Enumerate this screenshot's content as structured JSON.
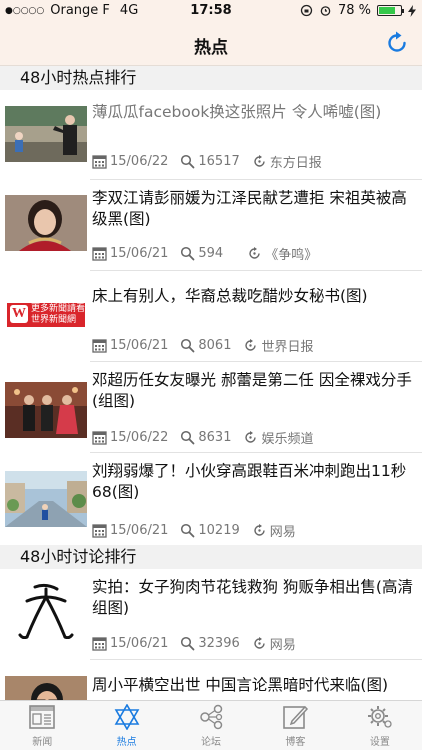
{
  "status": {
    "carrier": "Orange F",
    "network": "4G",
    "time": "17:58",
    "battery": "78 %",
    "battery_level": 0.78
  },
  "nav": {
    "title": "热点"
  },
  "sections": [
    {
      "title": "48小时热点排行"
    },
    {
      "title": "48小时讨论排行"
    }
  ],
  "articles": [
    {
      "title": "薄瓜瓜facebook换这张照片 令人唏嘘(图)",
      "date": "15/06/22",
      "views": "16517",
      "source": "东方日报",
      "read": true
    },
    {
      "title": "李双江请彭丽媛为江泽民献艺遭拒 宋祖英被高级黑(图)",
      "date": "15/06/21",
      "views": "594",
      "source": "《争鸣》",
      "read": false
    },
    {
      "title": "床上有别人，华裔总裁吃醋炒女秘书(图)",
      "date": "15/06/21",
      "views": "8061",
      "source": "世界日报",
      "read": false
    },
    {
      "title": "邓超历任女友曝光 郝蕾是第二任 因全裸戏分手(组图)",
      "date": "15/06/22",
      "views": "8631",
      "source": "娱乐频道",
      "read": false
    },
    {
      "title": "刘翔弱爆了！小伙穿高跟鞋百米冲刺跑出11秒68(图)",
      "date": "15/06/21",
      "views": "10219",
      "source": "网易",
      "read": false
    },
    {
      "title": "实拍：女子狗肉节花钱救狗 狗贩争相出售(高清组图)",
      "date": "15/06/21",
      "views": "32396",
      "source": "网易",
      "read": false
    },
    {
      "title": "周小平横空出世 中国言论黑暗时代来临(图)",
      "date": "",
      "views": "",
      "source": "",
      "read": false
    }
  ],
  "thumb_labels": {
    "wj_line1": "更多新聞請看",
    "wj_line2": "世界新聞網",
    "wj_mark": "W"
  },
  "tabs": [
    {
      "label": "新闻",
      "icon": "newspaper-icon",
      "active": false
    },
    {
      "label": "热点",
      "icon": "star-of-david-icon",
      "active": true
    },
    {
      "label": "论坛",
      "icon": "share-network-icon",
      "active": false
    },
    {
      "label": "博客",
      "icon": "edit-note-icon",
      "active": false
    },
    {
      "label": "设置",
      "icon": "gear-icon",
      "active": false
    }
  ],
  "colors": {
    "accent": "#1a7be0",
    "header_bg": "#fbf1ea",
    "section_bg": "#f1f1f1",
    "read_text": "#777777",
    "wj_red": "#d9252b"
  }
}
